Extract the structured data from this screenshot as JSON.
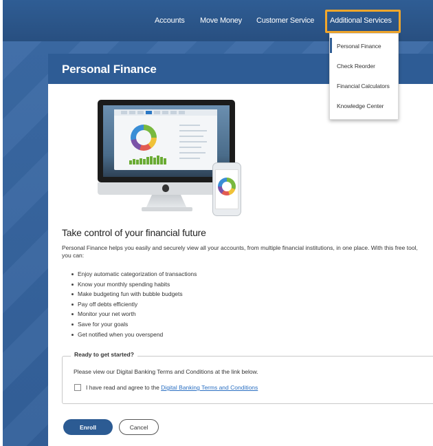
{
  "nav": {
    "items": [
      {
        "label": "Accounts"
      },
      {
        "label": "Move Money"
      },
      {
        "label": "Customer Service"
      },
      {
        "label": "Additional Services"
      }
    ],
    "active": "Additional Services"
  },
  "dropdown": {
    "items": [
      {
        "label": "Personal Finance",
        "selected": true
      },
      {
        "label": "Check Reorder"
      },
      {
        "label": "Financial Calculators"
      },
      {
        "label": "Knowledge Center"
      }
    ]
  },
  "page": {
    "title": "Personal Finance"
  },
  "main": {
    "headline": "Take control of your financial future",
    "intro": "Personal Finance helps you easily and securely view all your accounts, from multiple financial institutions, in one place. With this free tool, you can:",
    "benefits": [
      "Enjoy automatic categorization of transactions",
      "Know your monthly spending habits",
      "Make budgeting fun with bubble budgets",
      "Pay off debts efficiently",
      "Monitor your net worth",
      "Save for your goals",
      "Get notified when you overspend"
    ]
  },
  "enroll_form": {
    "legend": "Ready to get started?",
    "instruction": "Please view our Digital Banking Terms and Conditions at the link below.",
    "agree_prefix": "I have read and agree to the ",
    "agree_link": "Digital Banking Terms and Conditions",
    "checked": false
  },
  "buttons": {
    "enroll": "Enroll",
    "cancel": "Cancel"
  },
  "colors": {
    "nav_bg": "#2f5d94",
    "highlight": "#f2a72b",
    "primary_button": "#2c5b93",
    "link": "#2a6fc2"
  },
  "icons": {
    "device_illustration": "desktop-and-phone-illustration",
    "bullet": "bullet-icon",
    "checkbox": "checkbox-icon"
  }
}
